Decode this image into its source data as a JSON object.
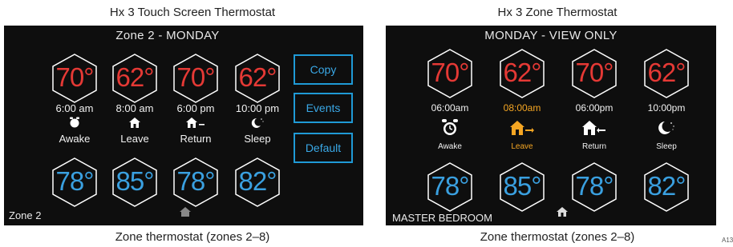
{
  "left": {
    "caption_top": "Hx 3 Touch Screen Thermostat",
    "title": "Zone 2 - MONDAY",
    "heat_temps": [
      "70°",
      "62°",
      "70°",
      "62°"
    ],
    "times": [
      "6:00 am",
      "8:00 am",
      "6:00 pm",
      "10:00 pm"
    ],
    "modes": [
      "Awake",
      "Leave",
      "Return",
      "Sleep"
    ],
    "cool_temps": [
      "78°",
      "85°",
      "78°",
      "82°"
    ],
    "buttons": {
      "copy": "Copy",
      "events": "Events",
      "default": "Default"
    },
    "zone_label": "Zone 2",
    "caption_bottom": "Zone thermostat (zones 2–8)"
  },
  "right": {
    "caption_top": "Hx 3 Zone Thermostat",
    "title": "MONDAY - VIEW ONLY",
    "heat_temps": [
      "70°",
      "62°",
      "70°",
      "62°"
    ],
    "times": [
      "06:00am",
      "08:00am",
      "06:00pm",
      "10:00pm"
    ],
    "modes": [
      "Awake",
      "Leave",
      "Return",
      "Sleep"
    ],
    "cool_temps": [
      "78°",
      "85°",
      "78°",
      "82°"
    ],
    "zone_label": "MASTER BEDROOM",
    "caption_bottom": "Zone thermostat (zones 2–8)",
    "selected_index": 1
  },
  "figure_code": "A13",
  "colors": {
    "heat": "#e53935",
    "cool": "#3aa0e0",
    "button": "#1f9ad6",
    "highlight": "#f5a623"
  }
}
